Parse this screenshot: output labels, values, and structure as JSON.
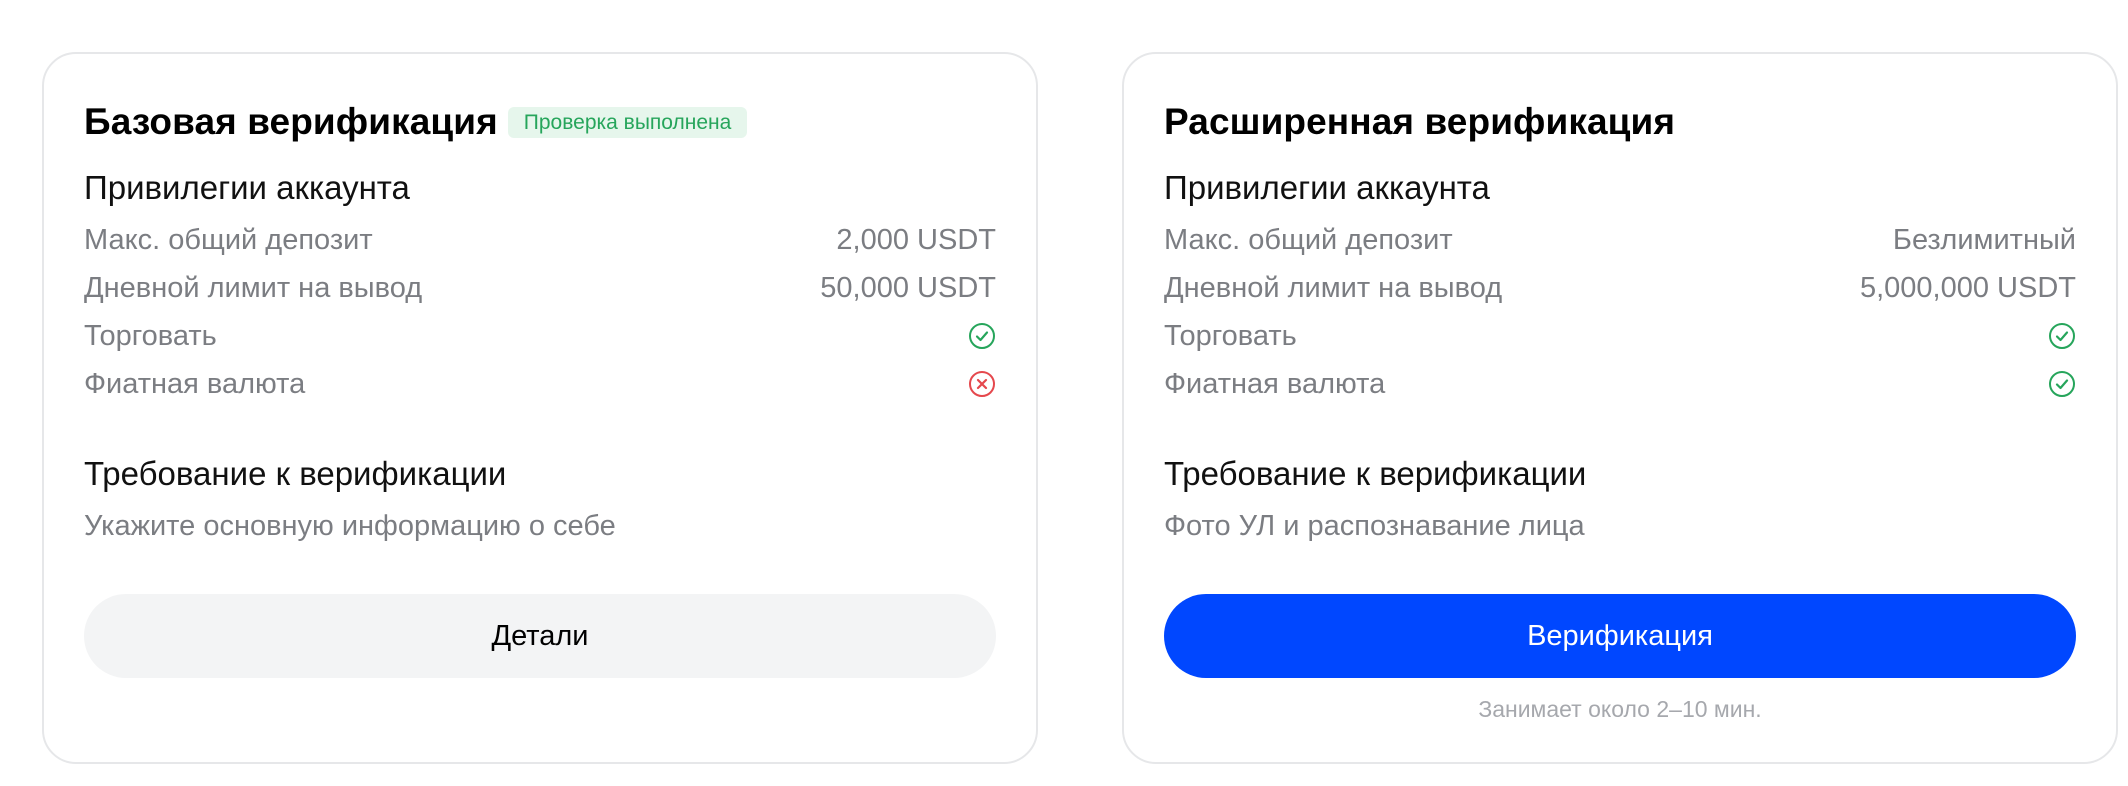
{
  "basic": {
    "title": "Базовая верификация",
    "badge": "Проверка выполнена",
    "privileges_title": "Привилегии аккаунта",
    "rows": [
      {
        "label": "Макс. общий депозит",
        "value": "2,000 USDT"
      },
      {
        "label": "Дневной лимит на вывод",
        "value": "50,000 USDT"
      },
      {
        "label": "Торговать",
        "icon": "check-circle-icon",
        "status": "allowed"
      },
      {
        "label": "Фиатная валюта",
        "icon": "cross-circle-icon",
        "status": "not-allowed"
      }
    ],
    "requirement_title": "Требование к верификации",
    "requirement_text": "Укажите основную информацию о себе",
    "button_label": "Детали"
  },
  "advanced": {
    "title": "Расширенная верификация",
    "privileges_title": "Привилегии аккаунта",
    "rows": [
      {
        "label": "Макс. общий депозит",
        "value": "Безлимитный"
      },
      {
        "label": "Дневной лимит на вывод",
        "value": "5,000,000 USDT"
      },
      {
        "label": "Торговать",
        "icon": "check-circle-icon",
        "status": "allowed"
      },
      {
        "label": "Фиатная валюта",
        "icon": "check-circle-icon",
        "status": "allowed"
      }
    ],
    "requirement_title": "Требование к верификации",
    "requirement_text": "Фото УЛ и распознавание лица",
    "button_label": "Верификация",
    "hint": "Занимает около 2–10 мин."
  },
  "colors": {
    "primary": "#0047ff",
    "success": "#26a55b",
    "danger": "#e5484d",
    "muted_text": "#7b7d82"
  }
}
